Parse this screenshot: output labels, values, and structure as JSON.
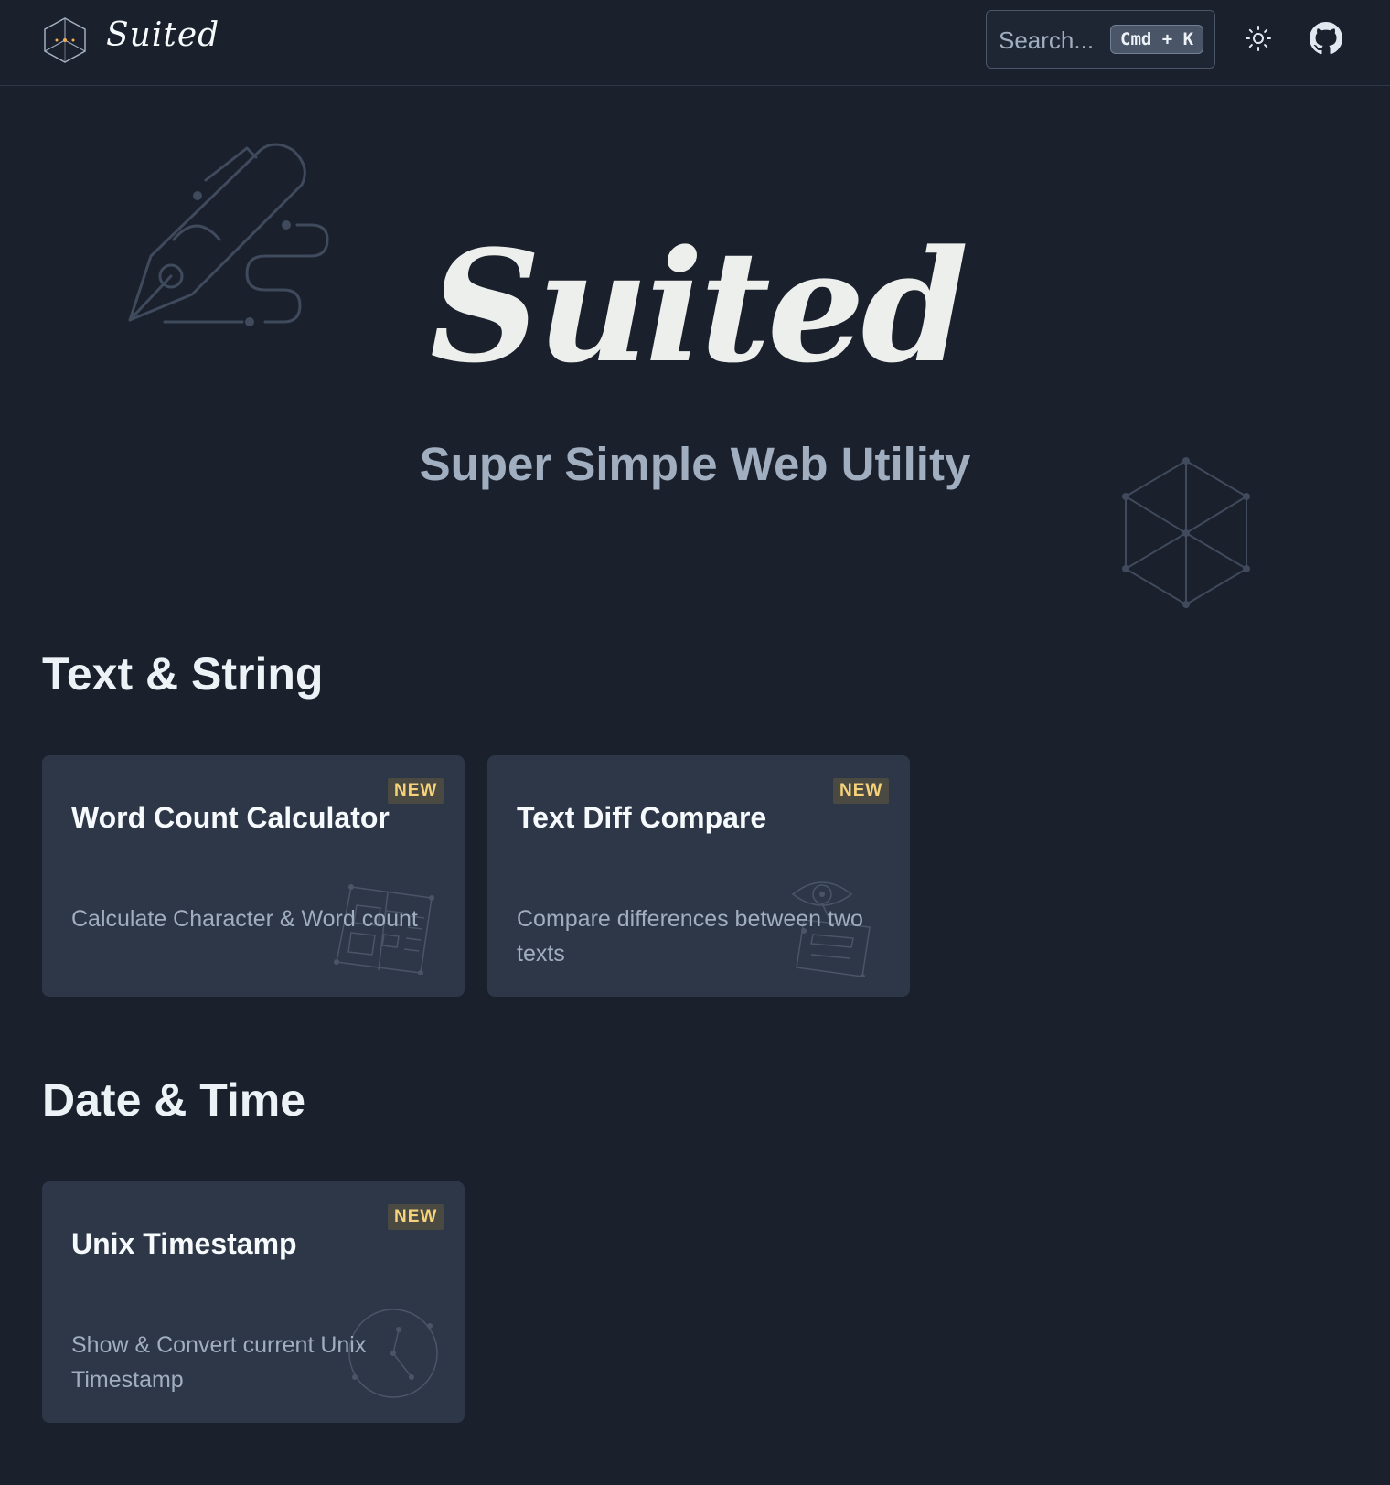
{
  "header": {
    "brand": "Suited",
    "search_placeholder": "Search...",
    "shortcut": "Cmd + K"
  },
  "hero": {
    "title": "Suited",
    "subtitle": "Super Simple Web Utility"
  },
  "sections": [
    {
      "title": "Text & String",
      "cards": [
        {
          "title": "Word Count Calculator",
          "badge": "NEW",
          "description": "Calculate Character & Word count"
        },
        {
          "title": "Text Diff Compare",
          "badge": "NEW",
          "description": "Compare differences between two texts"
        }
      ]
    },
    {
      "title": "Date & Time",
      "cards": [
        {
          "title": "Unix Timestamp",
          "badge": "NEW",
          "description": "Show & Convert current Unix Timestamp"
        }
      ]
    }
  ],
  "colors": {
    "background": "#1a202c",
    "card": "#2d3748",
    "badge_text": "#f6d37a",
    "subtitle": "#a0aec0"
  },
  "icons": [
    "suited-logo-icon",
    "sun-icon",
    "github-icon",
    "pen-illustration-icon",
    "cube-illustration-icon",
    "document-illustration-icon",
    "eye-document-illustration-icon",
    "clock-illustration-icon"
  ]
}
